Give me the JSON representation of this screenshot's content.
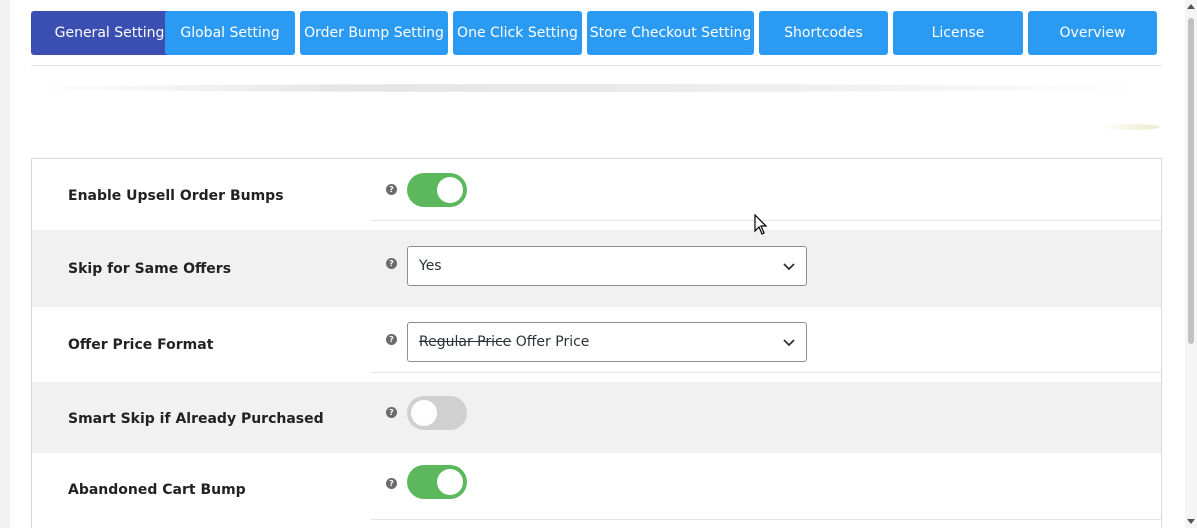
{
  "tabs": [
    {
      "label": "General Setting",
      "active": true
    },
    {
      "label": "Global Setting",
      "active": false
    },
    {
      "label": "Order Bump Setting",
      "active": false
    },
    {
      "label": "One Click Setting",
      "active": false
    },
    {
      "label": "Store Checkout Setting",
      "active": false
    },
    {
      "label": "Shortcodes",
      "active": false
    },
    {
      "label": "License",
      "active": false
    },
    {
      "label": "Overview",
      "active": false
    }
  ],
  "settings": {
    "enable_upsell": {
      "label": "Enable Upsell Order Bumps",
      "enabled": true,
      "help_glyph": "?"
    },
    "skip_same_offers": {
      "label": "Skip for Same Offers",
      "selected": "Yes",
      "help_glyph": "?"
    },
    "offer_price_format": {
      "label": "Offer Price Format",
      "selected_regular": "Regular Price",
      "selected_offer": "Offer Price",
      "help_glyph": "?"
    },
    "smart_skip": {
      "label": "Smart Skip if Already Purchased",
      "enabled": false,
      "help_glyph": "?"
    },
    "abandoned_cart": {
      "label": "Abandoned Cart Bump",
      "enabled": true,
      "help_glyph": "?"
    }
  },
  "colors": {
    "tab_default": "#2b9af3",
    "tab_active": "#3b4fb3",
    "toggle_on": "#5cb85c",
    "toggle_off": "#d0d0d0"
  },
  "icons": {
    "help": "question-circle-icon",
    "chevron": "chevron-down-icon",
    "cursor": "mouse-pointer-icon"
  }
}
